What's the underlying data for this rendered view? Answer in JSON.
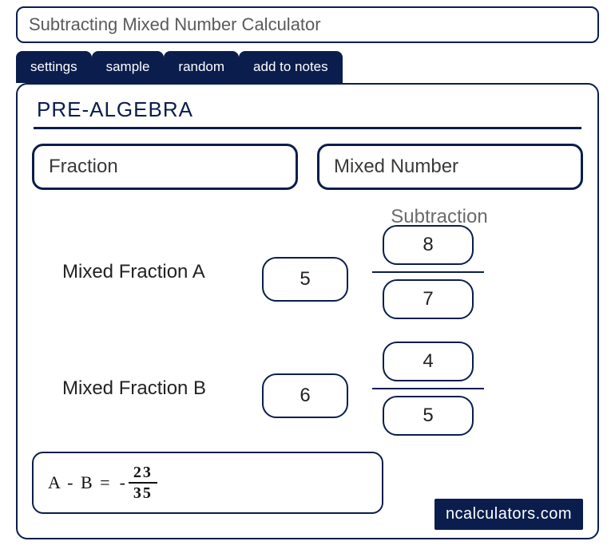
{
  "title": "Subtracting Mixed Number Calculator",
  "tabs": {
    "settings": "settings",
    "sample": "sample",
    "random": "random",
    "notes": "add to notes"
  },
  "section": "PRE-ALGEBRA",
  "types": {
    "fraction": "Fraction",
    "mixed": "Mixed Number"
  },
  "operation": "Subtraction",
  "rowA": {
    "label": "Mixed Fraction A",
    "whole": "5",
    "numerator": "8",
    "denominator": "7"
  },
  "rowB": {
    "label": "Mixed Fraction B",
    "whole": "6",
    "numerator": "4",
    "denominator": "5"
  },
  "result": {
    "lhs": "A - B  = ",
    "sign": "-",
    "numerator": "23",
    "denominator": "35"
  },
  "brand": "ncalculators.com"
}
